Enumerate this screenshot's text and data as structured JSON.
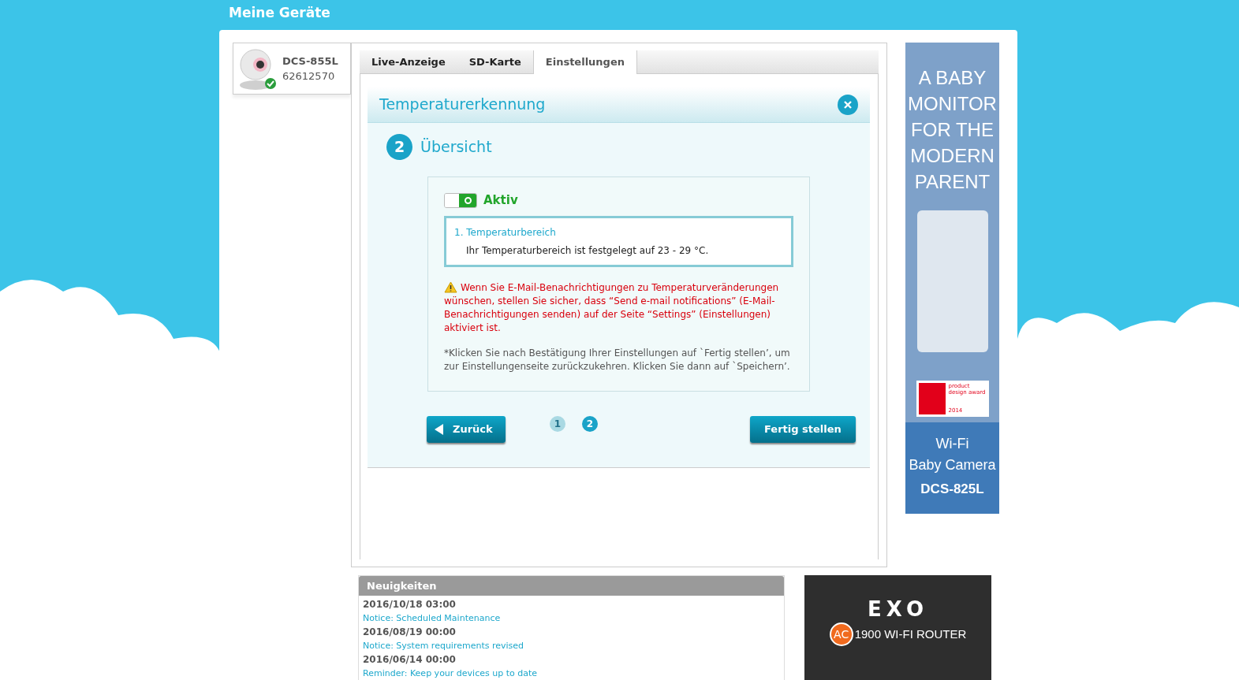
{
  "header": {
    "title": "Meine Geräte"
  },
  "device": {
    "model": "DCS-855L",
    "serial": "62612570",
    "online": true
  },
  "tabs": [
    {
      "label": "Live-Anzeige",
      "selected": false
    },
    {
      "label": "SD-Karte",
      "selected": false
    },
    {
      "label": "Einstellungen",
      "selected": true
    }
  ],
  "dialog": {
    "title": "Temperaturerkennung",
    "step_number": "2",
    "step_title": "Übersicht",
    "toggle": {
      "label": "Aktiv",
      "on": true
    },
    "summary": {
      "heading": "1. Temperaturbereich",
      "text": "Ihr Temperaturbereich ist festgelegt auf 23 - 29 °C."
    },
    "warning": "Wenn Sie E-Mail-Benachrichtigungen zu Temperaturveränderungen wünschen, stellen Sie sicher, dass “Send e-mail notifications” (E-Mail-Benachrichtigungen senden) auf der Seite “Settings” (Einstellungen) aktiviert ist.",
    "note": "*Klicken Sie nach Bestätigung Ihrer Einstellungen auf `Fertig stellen’, um zur Einstellungenseite zurückzukehren. Klicken Sie dann auf `Speichern’.",
    "back_button": "Zurück",
    "pager": [
      {
        "label": "1",
        "selected": false
      },
      {
        "label": "2",
        "selected": true
      }
    ],
    "finish_button": "Fertig stellen"
  },
  "side_ad": {
    "headline": "A BABY MONITOR FOR THE MODERN PARENT",
    "award_label": "product design award",
    "award_year": "2014",
    "product_line_1": "Wi-Fi",
    "product_line_2": "Baby Camera",
    "product_model": "DCS-825L"
  },
  "news": {
    "title": "Neuigkeiten",
    "items": [
      {
        "date": "2016/10/18 03:00",
        "link": "Notice: Scheduled Maintenance"
      },
      {
        "date": "2016/08/19 00:00",
        "link": "Notice: System requirements revised"
      },
      {
        "date": "2016/06/14 00:00",
        "link": "Reminder: Keep your devices up to date"
      }
    ]
  },
  "bottom_ad": {
    "brand": "EXO",
    "badge": "AC",
    "tagline": "1900 WI-FI ROUTER"
  }
}
